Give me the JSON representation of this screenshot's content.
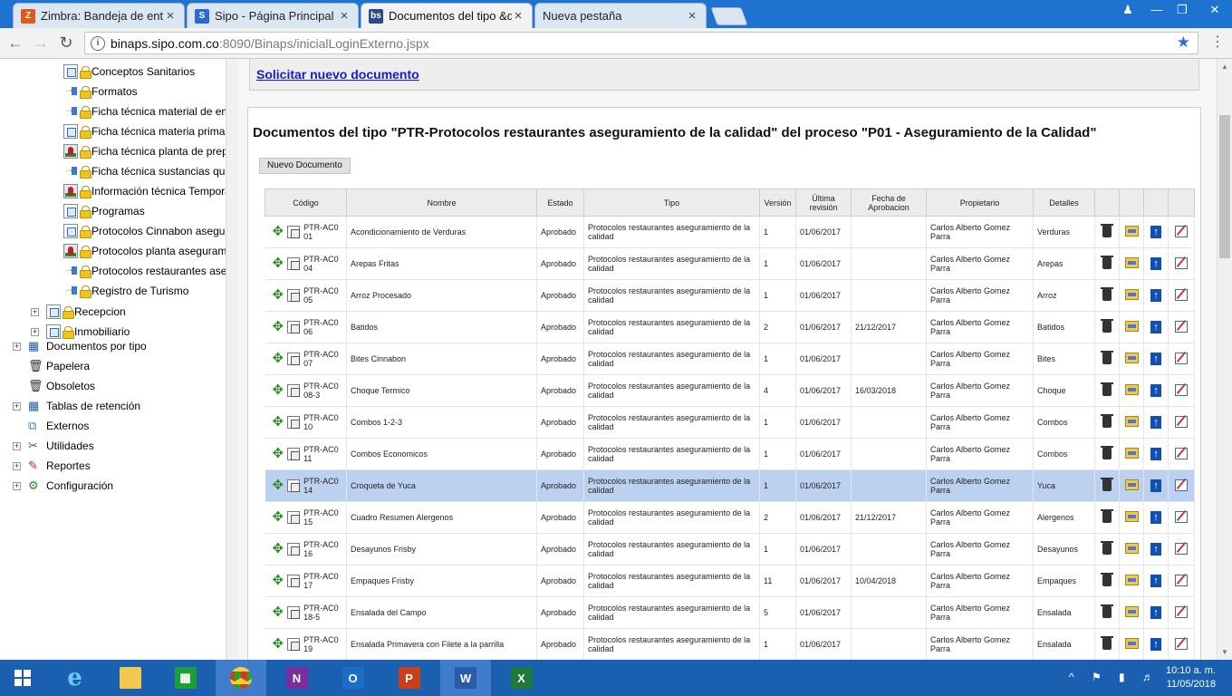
{
  "tabs": [
    {
      "title": "Zimbra: Bandeja de entra",
      "favicon": "Z",
      "color": "#e05a1a"
    },
    {
      "title": "Sipo - Página Principal",
      "favicon": "S",
      "color": "#2a6ad0"
    },
    {
      "title": "Documentos del tipo &q",
      "favicon": "bs",
      "color": "#2a4a8a"
    },
    {
      "title": "Nueva pestaña",
      "favicon": "",
      "color": ""
    }
  ],
  "url": {
    "host": "binaps.sipo.com.co",
    "path": ":8090/Binaps/inicialLoginExterno.jspx"
  },
  "tree": [
    {
      "label": "Conceptos Sanitarios",
      "icon": "doc"
    },
    {
      "label": "Formatos",
      "icon": "flow"
    },
    {
      "label": "Ficha técnica material de emp",
      "icon": "flow"
    },
    {
      "label": "Ficha técnica materia prima a",
      "icon": "doc"
    },
    {
      "label": "Ficha técnica planta de prepa",
      "icon": "pic"
    },
    {
      "label": "Ficha técnica sustancias quín",
      "icon": "flow"
    },
    {
      "label": "Información técnica Temporal",
      "icon": "pic"
    },
    {
      "label": "Programas",
      "icon": "doc"
    },
    {
      "label": "Protocolos Cinnabon asegura",
      "icon": "doc"
    },
    {
      "label": "Protocolos planta asegurami",
      "icon": "pic"
    },
    {
      "label": "Protocolos restaurantes aseg",
      "icon": "flow"
    },
    {
      "label": "Registro de Turismo",
      "icon": "flow"
    }
  ],
  "tree_groups": [
    {
      "label": "Recepcion"
    },
    {
      "label": "Inmobiliario"
    }
  ],
  "tree_root": [
    {
      "label": "Documentos por tipo",
      "icon": "table-icon",
      "expand": true
    },
    {
      "label": "Papelera",
      "icon": "trash-icon",
      "expand": false
    },
    {
      "label": "Obsoletos",
      "icon": "trash-icon",
      "expand": false
    },
    {
      "label": "Tablas de retención",
      "icon": "table-icon",
      "expand": true
    },
    {
      "label": "Externos",
      "icon": "external-icon",
      "expand": false
    },
    {
      "label": "Utilidades",
      "icon": "tools-icon",
      "expand": true
    },
    {
      "label": "Reportes",
      "icon": "pdf-icon",
      "expand": true
    },
    {
      "label": "Configuración",
      "icon": "config-icon",
      "expand": true
    }
  ],
  "main": {
    "request_link": "Solicitar nuevo documento",
    "title": "Documentos del tipo \"PTR-Protocolos restaurantes aseguramiento de la calidad\" del proceso \"P01 - Aseguramiento de la Calidad\"",
    "new_doc_button": "Nuevo Documento"
  },
  "table": {
    "headers": [
      "Código",
      "Nombre",
      "Estado",
      "Tipo",
      "Versión",
      "Última revisión",
      "Fecha de Aprobacion",
      "Propietario",
      "Detalles",
      "",
      "",
      "",
      ""
    ],
    "rows": [
      {
        "code": "PTR-AC001",
        "name": "Acondicionamiento de Verduras",
        "state": "Aprobado",
        "type": "Protocolos restaurantes aseguramiento de la calidad",
        "version": "1",
        "rev": "01/06/2017",
        "approved": "",
        "owner": "Carlos Alberto Gomez Parra",
        "details": "Verduras"
      },
      {
        "code": "PTR-AC004",
        "name": "Arepas Fritas",
        "state": "Aprobado",
        "type": "Protocolos restaurantes aseguramiento de la calidad",
        "version": "1",
        "rev": "01/06/2017",
        "approved": "",
        "owner": "Carlos Alberto Gomez Parra",
        "details": "Arepas"
      },
      {
        "code": "PTR-AC005",
        "name": "Arroz Procesado",
        "state": "Aprobado",
        "type": "Protocolos restaurantes aseguramiento de la calidad",
        "version": "1",
        "rev": "01/06/2017",
        "approved": "",
        "owner": "Carlos Alberto Gomez Parra",
        "details": "Arroz"
      },
      {
        "code": "PTR-AC006",
        "name": "Batidos",
        "state": "Aprobado",
        "type": "Protocolos restaurantes aseguramiento de la calidad",
        "version": "2",
        "rev": "01/06/2017",
        "approved": "21/12/2017",
        "owner": "Carlos Alberto Gomez Parra",
        "details": "Batidos"
      },
      {
        "code": "PTR-AC007",
        "name": "Bites Cinnabon",
        "state": "Aprobado",
        "type": "Protocolos restaurantes aseguramiento de la calidad",
        "version": "1",
        "rev": "01/06/2017",
        "approved": "",
        "owner": "Carlos Alberto Gomez Parra",
        "details": "Bites"
      },
      {
        "code": "PTR-AC008-3",
        "name": "Choque Termico",
        "state": "Aprobado",
        "type": "Protocolos restaurantes aseguramiento de la calidad",
        "version": "4",
        "rev": "01/06/2017",
        "approved": "16/03/2018",
        "owner": "Carlos Alberto Gomez Parra",
        "details": "Choque"
      },
      {
        "code": "PTR-AC010",
        "name": "Combos 1-2-3",
        "state": "Aprobado",
        "type": "Protocolos restaurantes aseguramiento de la calidad",
        "version": "1",
        "rev": "01/06/2017",
        "approved": "",
        "owner": "Carlos Alberto Gomez Parra",
        "details": "Combos"
      },
      {
        "code": "PTR-AC011",
        "name": "Combos Economicos",
        "state": "Aprobado",
        "type": "Protocolos restaurantes aseguramiento de la calidad",
        "version": "1",
        "rev": "01/06/2017",
        "approved": "",
        "owner": "Carlos Alberto Gomez Parra",
        "details": "Combos"
      },
      {
        "code": "PTR-AC014",
        "name": "Croqueta de Yuca",
        "state": "Aprobado",
        "type": "Protocolos restaurantes aseguramiento de la calidad",
        "version": "1",
        "rev": "01/06/2017",
        "approved": "",
        "owner": "Carlos Alberto Gomez Parra",
        "details": "Yuca",
        "highlight": true
      },
      {
        "code": "PTR-AC015",
        "name": "Cuadro Resumen Alergenos",
        "state": "Aprobado",
        "type": "Protocolos restaurantes aseguramiento de la calidad",
        "version": "2",
        "rev": "01/06/2017",
        "approved": "21/12/2017",
        "owner": "Carlos Alberto Gomez Parra",
        "details": "Alergenos"
      },
      {
        "code": "PTR-AC016",
        "name": "Desayunos Frisby",
        "state": "Aprobado",
        "type": "Protocolos restaurantes aseguramiento de la calidad",
        "version": "1",
        "rev": "01/06/2017",
        "approved": "",
        "owner": "Carlos Alberto Gomez Parra",
        "details": "Desayunos"
      },
      {
        "code": "PTR-AC017",
        "name": "Empaques Frisby",
        "state": "Aprobado",
        "type": "Protocolos restaurantes aseguramiento de la calidad",
        "version": "11",
        "rev": "01/06/2017",
        "approved": "10/04/2018",
        "owner": "Carlos Alberto Gomez Parra",
        "details": "Empaques"
      },
      {
        "code": "PTR-AC018-5",
        "name": "Ensalada del Campo",
        "state": "Aprobado",
        "type": "Protocolos restaurantes aseguramiento de la calidad",
        "version": "5",
        "rev": "01/06/2017",
        "approved": "",
        "owner": "Carlos Alberto Gomez Parra",
        "details": "Ensalada"
      },
      {
        "code": "PTR-AC019",
        "name": "Ensalada Primavera con Filete a la parrilla",
        "state": "Aprobado",
        "type": "Protocolos restaurantes aseguramiento de la calidad",
        "version": "1",
        "rev": "01/06/2017",
        "approved": "",
        "owner": "Carlos Alberto Gomez Parra",
        "details": "Ensalada"
      }
    ]
  },
  "taskbar": {
    "time": "10:10 a. m.",
    "date": "11/05/2018"
  },
  "colors": {
    "tabbar": "#1e72d0",
    "link": "#1a1acc",
    "highlight": "#bcd1ef",
    "taskbar": "#1a5fb0"
  }
}
